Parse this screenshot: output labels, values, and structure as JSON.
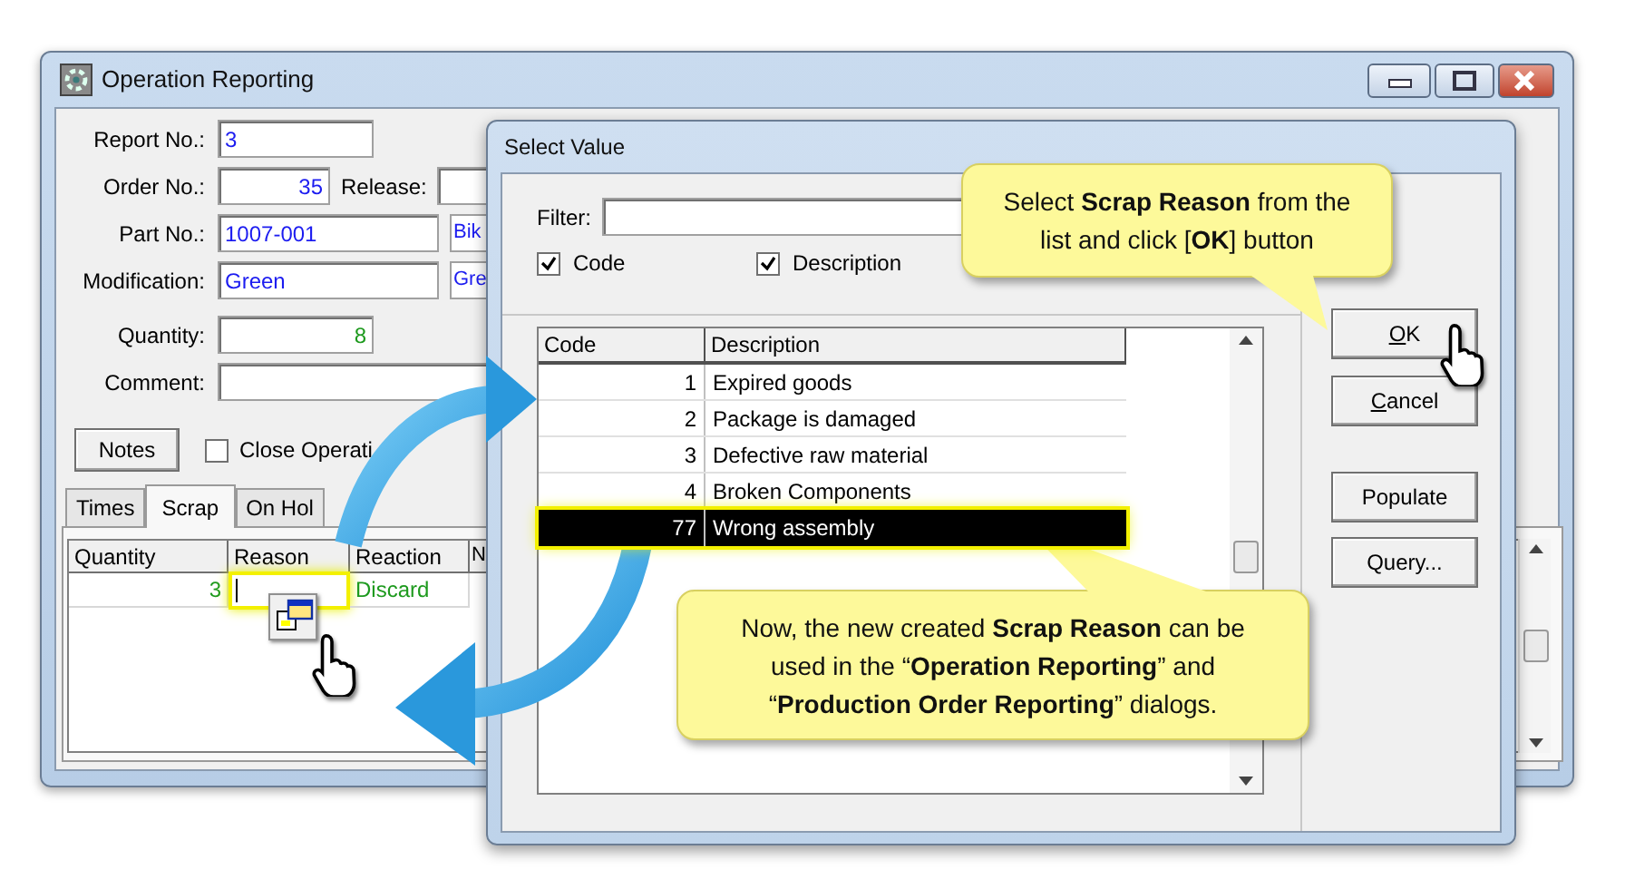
{
  "main_window": {
    "title": "Operation Reporting",
    "fields": [
      {
        "label": "Report No.:",
        "value": "3",
        "color": "#1c1cf0"
      },
      {
        "label": "Order No.:",
        "value": "35",
        "color": "#1c1cf0",
        "extra_label": "Release:"
      },
      {
        "label": "Part No.:",
        "value": "1007-001",
        "color": "#1c1cf0",
        "extra": "Bik"
      },
      {
        "label": "Modification:",
        "value": "Green",
        "color": "#1c1cf0",
        "extra": "Gre"
      },
      {
        "label": "Quantity:",
        "value": "8",
        "color": "#1e9a1e"
      },
      {
        "label": "Comment:"
      }
    ],
    "notes_button": "Notes",
    "close_operation": {
      "label": "Close Operati",
      "checked": false
    },
    "tabs": [
      {
        "label": "Times",
        "selected": false
      },
      {
        "label": "Scrap",
        "selected": true
      },
      {
        "label": "On Hol",
        "selected": false
      }
    ],
    "scrap_table": {
      "columns": [
        "Quantity",
        "Reason",
        "Reaction",
        "N"
      ],
      "rows": [
        {
          "quantity": "3",
          "reaction": "Discard"
        }
      ]
    }
  },
  "dialog": {
    "title": "Select Value",
    "filter": {
      "label": "Filter:"
    },
    "search_in": [
      {
        "label": "Code",
        "checked": true
      },
      {
        "label": "Description",
        "checked": true
      }
    ],
    "columns": [
      "Code",
      "Description"
    ],
    "rows": [
      {
        "code": "1",
        "description": "Expired goods",
        "selected": false
      },
      {
        "code": "2",
        "description": "Package is damaged",
        "selected": false
      },
      {
        "code": "3",
        "description": "Defective raw material",
        "selected": false
      },
      {
        "code": "4",
        "description": "Broken Components",
        "selected": false
      },
      {
        "code": "77",
        "description": "Wrong assembly",
        "selected": true
      }
    ],
    "buttons": [
      "OK",
      "Cancel",
      "Populate",
      "Query..."
    ]
  },
  "callouts": [
    "Select **Scrap Reason** from the list and click [**OK**] button",
    "Now, the new created **Scrap Reason** can be used in the “**Operation Reporting**” and “**Production Order Reporting**” dialogs."
  ]
}
